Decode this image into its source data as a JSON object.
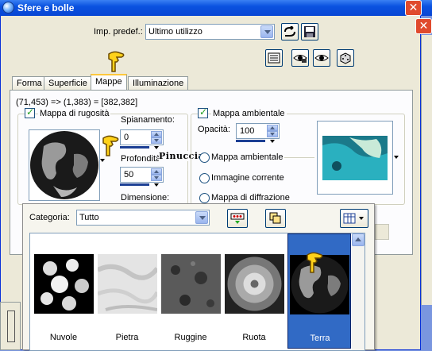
{
  "window": {
    "title": "Sfere e bolle"
  },
  "preset": {
    "label": "Imp. predef.:",
    "value": "Ultimo utilizzo"
  },
  "tabs": [
    {
      "label": "Forma",
      "active": false
    },
    {
      "label": "Superficie",
      "active": false
    },
    {
      "label": "Mappe",
      "active": true
    },
    {
      "label": "Illuminazione",
      "active": false
    }
  ],
  "coords": "(71,453) => (1,383) = [382,382]",
  "bump": {
    "checkbox_label": "Mappa di rugosità",
    "smoothing_label": "Spianamento:",
    "smoothing_value": "0",
    "depth_label": "Profondità:",
    "depth_value": "50",
    "size_label": "Dimensione:"
  },
  "env": {
    "checkbox_label": "Mappa ambientale",
    "opacity_label": "Opacità:",
    "opacity_value": "100",
    "options": [
      "Mappa ambientale",
      "Immagine corrente",
      "Mappa di diffrazione"
    ]
  },
  "watermark": "Pinuccia",
  "popup": {
    "category_label": "Categoria:",
    "category_value": "Tutto",
    "items": [
      {
        "label": "Nuvole",
        "selected": false
      },
      {
        "label": "Pietra",
        "selected": false
      },
      {
        "label": "Ruggine",
        "selected": false
      },
      {
        "label": "Ruota",
        "selected": false
      },
      {
        "label": "Terra",
        "selected": true
      }
    ]
  },
  "icons": [
    "app-icon",
    "close-icon",
    "rename-icon",
    "save-preset-icon",
    "reset-icon",
    "lock-eye-icon",
    "eye-icon",
    "random-dice-icon",
    "pointing-hand-icon",
    "grid-view-icon",
    "copy-icon",
    "sort-icon",
    "scroll-up-icon"
  ],
  "colors": {
    "titlebar": "#0a52e0",
    "selection": "#316ac5",
    "dialog_bg": "#ece9d8",
    "close": "#e04a2d"
  }
}
